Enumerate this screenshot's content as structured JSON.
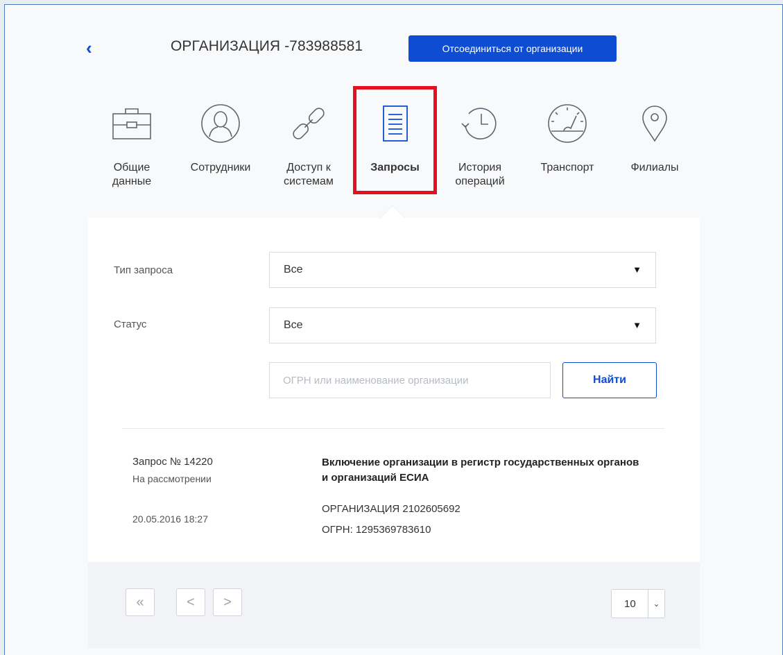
{
  "header": {
    "back_icon": "chevron-left-icon",
    "org_title": "ОРГАНИЗАЦИЯ -783988581",
    "disconnect_label": "Отсоединиться от организации"
  },
  "tabs": [
    {
      "label_line1": "Общие",
      "label_line2": "данные",
      "icon": "briefcase-icon"
    },
    {
      "label_line1": "Сотрудники",
      "label_line2": "",
      "icon": "user-circle-icon"
    },
    {
      "label_line1": "Доступ к",
      "label_line2": "системам",
      "icon": "chain-link-icon"
    },
    {
      "label_line1": "Запросы",
      "label_line2": "",
      "icon": "document-lines-icon",
      "active": true
    },
    {
      "label_line1": "История",
      "label_line2": "операций",
      "icon": "history-clock-icon"
    },
    {
      "label_line1": "Транспорт",
      "label_line2": "",
      "icon": "speedometer-icon"
    },
    {
      "label_line1": "Филиалы",
      "label_line2": "",
      "icon": "map-pin-icon"
    }
  ],
  "filters": {
    "type_label": "Тип запроса",
    "type_value": "Все",
    "status_label": "Статус",
    "status_value": "Все",
    "search_placeholder": "ОГРН или наименование организации",
    "search_value": "",
    "find_label": "Найти"
  },
  "request": {
    "number": "Запрос № 14220",
    "status": "На рассмотрении",
    "date": "20.05.2016 18:27",
    "title": "Включение организации в регистр государственных органов и организаций ЕСИА",
    "org": "ОРГАНИЗАЦИЯ 2102605692",
    "ogrn": "ОГРН: 1295369783610"
  },
  "pagination": {
    "first": "«",
    "prev": "<",
    "next": ">",
    "per_page": "10"
  },
  "colors": {
    "accent": "#0d4cd3",
    "highlight": "#e3101f",
    "icon": "#5d6670",
    "active_icon": "#0d4cd3"
  }
}
